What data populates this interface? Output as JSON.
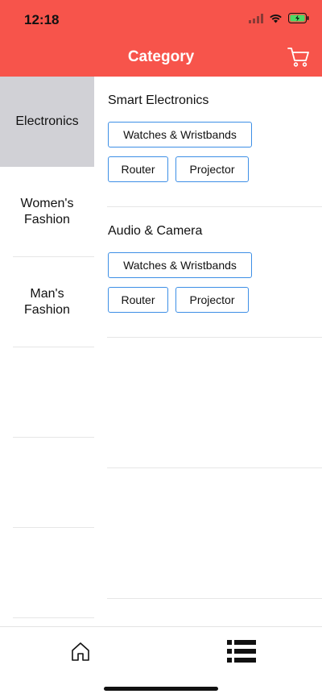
{
  "status_bar": {
    "time": "12:18"
  },
  "header": {
    "title": "Category",
    "cart_icon": "cart-icon",
    "accent_color": "#f7544b"
  },
  "sidebar": {
    "items": [
      {
        "label": "Electronics",
        "active": true
      },
      {
        "label": "Women's Fashion",
        "active": false
      },
      {
        "label": "Man's Fashion",
        "active": false
      },
      {
        "label": "",
        "active": false
      },
      {
        "label": "",
        "active": false
      },
      {
        "label": "",
        "active": false
      }
    ]
  },
  "sections": [
    {
      "title": "Smart Electronics",
      "chips": [
        "Watches & Wristbands",
        "Router",
        "Projector"
      ]
    },
    {
      "title": "Audio & Camera",
      "chips": [
        "Watches & Wristbands",
        "Router",
        "Projector"
      ]
    }
  ],
  "chip_border_color": "#3d8fe6",
  "tabbar": {
    "tabs": [
      {
        "icon": "home-icon"
      },
      {
        "icon": "list-icon"
      }
    ]
  }
}
